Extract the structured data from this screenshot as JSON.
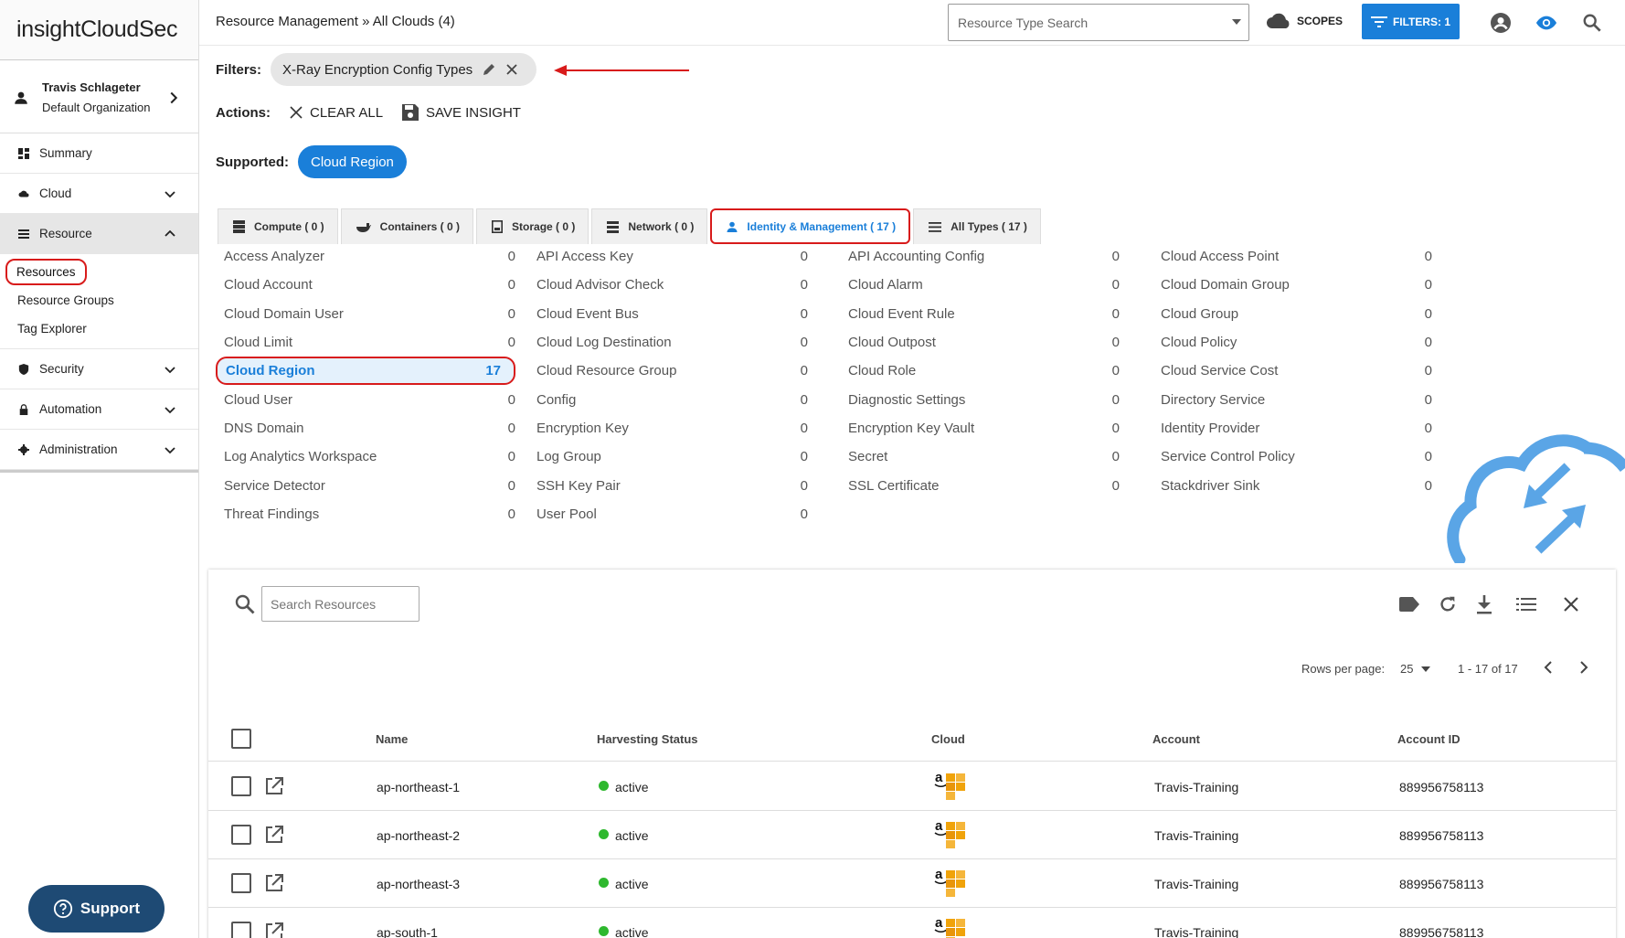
{
  "app": {
    "logo_prefix": "insight",
    "logo_suffix": "CloudSec"
  },
  "user": {
    "name": "Travis Schlageter",
    "org": "Default Organization"
  },
  "nav": {
    "summary": "Summary",
    "cloud": "Cloud",
    "resource": "Resource",
    "sub": [
      "Resources",
      "Resource Groups",
      "Tag Explorer"
    ],
    "security": "Security",
    "automation": "Automation",
    "administration": "Administration"
  },
  "support": "Support",
  "header": {
    "breadcrumb": "Resource Management » All Clouds (4)",
    "search_placeholder": "Resource Type Search",
    "scopes": "SCOPES",
    "filters_btn": "FILTERS: 1"
  },
  "filters": {
    "label": "Filters:",
    "chip": "X-Ray Encryption Config Types",
    "actions_label": "Actions:",
    "clear_all": "CLEAR ALL",
    "save_insight": "SAVE INSIGHT",
    "supported_label": "Supported:",
    "supported_pill": "Cloud Region"
  },
  "tabs": [
    "Compute ( 0 )",
    "Containers ( 0 )",
    "Storage ( 0 )",
    "Network ( 0 )",
    "Identity & Management ( 17 )",
    "All Types ( 17 )"
  ],
  "types": [
    [
      {
        "n": "Access Analyzer",
        "c": "0"
      },
      {
        "n": "Cloud Account",
        "c": "0"
      },
      {
        "n": "Cloud Domain User",
        "c": "0"
      },
      {
        "n": "Cloud Limit",
        "c": "0"
      },
      {
        "n": "Cloud Region",
        "c": "17"
      },
      {
        "n": "Cloud User",
        "c": "0"
      },
      {
        "n": "DNS Domain",
        "c": "0"
      },
      {
        "n": "Log Analytics Workspace",
        "c": "0"
      },
      {
        "n": "Service Detector",
        "c": "0"
      },
      {
        "n": "Threat Findings",
        "c": "0"
      }
    ],
    [
      {
        "n": "API Access Key",
        "c": "0"
      },
      {
        "n": "Cloud Advisor Check",
        "c": "0"
      },
      {
        "n": "Cloud Event Bus",
        "c": "0"
      },
      {
        "n": "Cloud Log Destination",
        "c": "0"
      },
      {
        "n": "Cloud Resource Group",
        "c": "0"
      },
      {
        "n": "Config",
        "c": "0"
      },
      {
        "n": "Encryption Key",
        "c": "0"
      },
      {
        "n": "Log Group",
        "c": "0"
      },
      {
        "n": "SSH Key Pair",
        "c": "0"
      },
      {
        "n": "User Pool",
        "c": "0"
      }
    ],
    [
      {
        "n": "API Accounting Config",
        "c": "0"
      },
      {
        "n": "Cloud Alarm",
        "c": "0"
      },
      {
        "n": "Cloud Event Rule",
        "c": "0"
      },
      {
        "n": "Cloud Outpost",
        "c": "0"
      },
      {
        "n": "Cloud Role",
        "c": "0"
      },
      {
        "n": "Diagnostic Settings",
        "c": "0"
      },
      {
        "n": "Encryption Key Vault",
        "c": "0"
      },
      {
        "n": "Secret",
        "c": "0"
      },
      {
        "n": "SSL Certificate",
        "c": "0"
      }
    ],
    [
      {
        "n": "Cloud Access Point",
        "c": "0"
      },
      {
        "n": "Cloud Domain Group",
        "c": "0"
      },
      {
        "n": "Cloud Group",
        "c": "0"
      },
      {
        "n": "Cloud Policy",
        "c": "0"
      },
      {
        "n": "Cloud Service Cost",
        "c": "0"
      },
      {
        "n": "Directory Service",
        "c": "0"
      },
      {
        "n": "Identity Provider",
        "c": "0"
      },
      {
        "n": "Service Control Policy",
        "c": "0"
      },
      {
        "n": "Stackdriver Sink",
        "c": "0"
      }
    ]
  ],
  "table": {
    "search_placeholder": "Search Resources",
    "rows_per_page_label": "Rows per page:",
    "rows_per_page": "25",
    "range": "1 - 17 of 17",
    "columns": [
      "Name",
      "Harvesting Status",
      "Cloud",
      "Account",
      "Account ID"
    ],
    "rows": [
      {
        "name": "ap-northeast-1",
        "status": "active",
        "account": "Travis-Training",
        "account_id": "889956758113"
      },
      {
        "name": "ap-northeast-2",
        "status": "active",
        "account": "Travis-Training",
        "account_id": "889956758113"
      },
      {
        "name": "ap-northeast-3",
        "status": "active",
        "account": "Travis-Training",
        "account_id": "889956758113"
      },
      {
        "name": "ap-south-1",
        "status": "active",
        "account": "Travis-Training",
        "account_id": "889956758113"
      }
    ]
  },
  "colors": {
    "accent": "#1a7fd9",
    "highlight": "#d81b1b",
    "support": "#1e4a74",
    "active": "#2eb82e",
    "aws": "#f0a30a"
  }
}
